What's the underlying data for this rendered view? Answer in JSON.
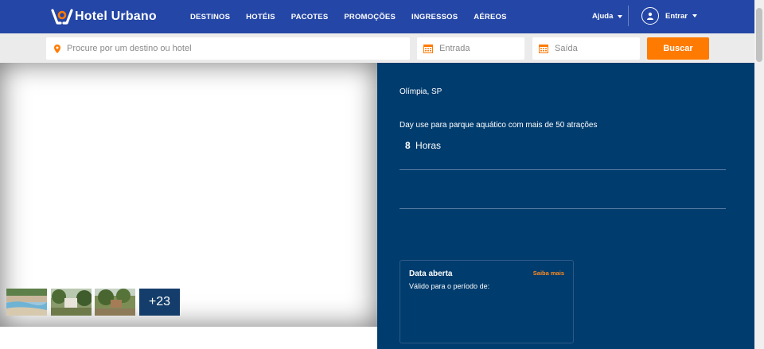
{
  "header": {
    "brand": "Hotel Urbano",
    "nav": [
      "DESTINOS",
      "HOTÉIS",
      "PACOTES",
      "PROMOÇÕES",
      "INGRESSOS",
      "AÉREOS"
    ],
    "help_label": "Ajuda",
    "login_label": "Entrar"
  },
  "search": {
    "destination_placeholder": "Procure por um destino ou hotel",
    "checkin_placeholder": "Entrada",
    "checkout_placeholder": "Saída",
    "button_label": "Buscar"
  },
  "gallery": {
    "more_count": "+23"
  },
  "offer": {
    "location": "Olímpia, SP",
    "description": "Day use para parque aquático com mais de 50 atrações",
    "duration_value": "8",
    "duration_unit": "Horas",
    "date_card": {
      "title": "Data aberta",
      "link": "Saiba mais",
      "subtitle": "Válido para o período de:"
    }
  },
  "colors": {
    "header_bg": "#2446a6",
    "panel_bg": "#003c6e",
    "accent": "#ff7a00"
  }
}
